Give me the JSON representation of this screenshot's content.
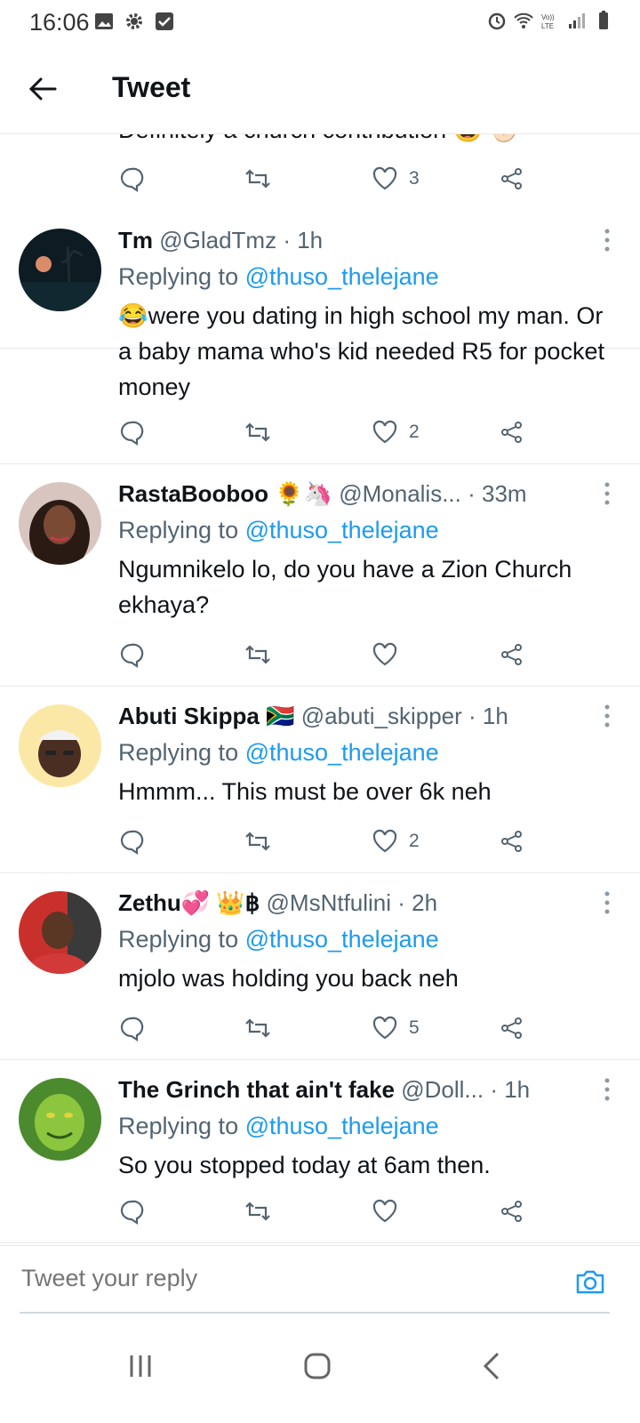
{
  "status_bar": {
    "time": "16:06"
  },
  "header": {
    "title": "Tweet"
  },
  "partial_tweet": {
    "text": "Definitely a church contribution 😅 ✊🏻",
    "like_count": "3"
  },
  "tweets": [
    {
      "name": "Tm",
      "handle": "@GladTmz",
      "time": "· 1h",
      "replying_prefix": "Replying to ",
      "replying_to": "@thuso_thelejane",
      "text": "😂were you dating in high school my man. Or a baby mama who's kid needed R5 for pocket money",
      "like_count": "2"
    },
    {
      "name": "RastaBooboo 🌻🦄",
      "handle": "@Monalis...",
      "time": "· 33m",
      "replying_prefix": "Replying to ",
      "replying_to": "@thuso_thelejane",
      "text": "Ngumnikelo lo, do you have a Zion Church ekhaya?",
      "like_count": ""
    },
    {
      "name": "Abuti Skippa 🇿🇦",
      "handle": "@abuti_skipper",
      "time": "· 1h",
      "replying_prefix": "Replying to ",
      "replying_to": "@thuso_thelejane",
      "text": "Hmmm... This must be over 6k neh",
      "like_count": "2"
    },
    {
      "name": "Zethu💞 👑฿",
      "handle": "@MsNtfulini",
      "time": "· 2h",
      "replying_prefix": "Replying to ",
      "replying_to": "@thuso_thelejane",
      "text": "mjolo was holding you back neh",
      "like_count": "5"
    },
    {
      "name": "The Grinch that ain't fake",
      "handle": "@Doll...",
      "time": "· 1h",
      "replying_prefix": "Replying to ",
      "replying_to": "@thuso_thelejane",
      "text": "So you stopped today at 6am then.",
      "like_count": ""
    }
  ],
  "composer": {
    "placeholder": "Tweet your reply"
  },
  "colors": {
    "accent": "#1d9bf0",
    "text": "#0f1419",
    "secondary": "#536471",
    "divider": "#e6e9ec"
  }
}
